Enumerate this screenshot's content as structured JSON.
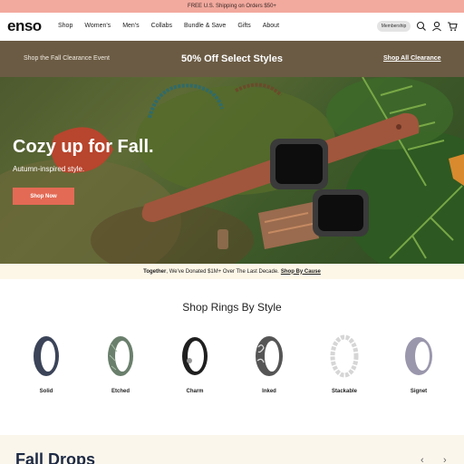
{
  "announcement": "FREE U.S. Shipping on Orders $50+",
  "nav": {
    "logo": "enso",
    "links": [
      "Shop",
      "Women's",
      "Men's",
      "Collabs",
      "Bundle & Save",
      "Gifts",
      "About"
    ],
    "membership": "Membership",
    "icons": [
      "search-icon",
      "user-icon",
      "cart-icon"
    ]
  },
  "promo": {
    "left": "Shop the Fall Clearance Event",
    "center": "50% Off Select Styles",
    "right": "Shop All Clearance"
  },
  "hero": {
    "title": "Cozy up for Fall.",
    "subtitle": "Autumn-inspired style.",
    "button": "Shop Now"
  },
  "cause": {
    "bold": "Together",
    "text": ", We've Donated $1M+ Over The Last Decade.",
    "link": "Shop By Cause"
  },
  "rings": {
    "title": "Shop Rings By Style",
    "items": [
      {
        "label": "Solid",
        "color": "#3b4458"
      },
      {
        "label": "Etched",
        "color": "#6a7f6c"
      },
      {
        "label": "Charm",
        "color": "#1f1f1f"
      },
      {
        "label": "Inked",
        "color": "#555555"
      },
      {
        "label": "Stackable",
        "color": "#e8e8e8"
      },
      {
        "label": "Signet",
        "color": "#9a97ac"
      }
    ]
  },
  "fall": {
    "title": "Fall Drops"
  }
}
